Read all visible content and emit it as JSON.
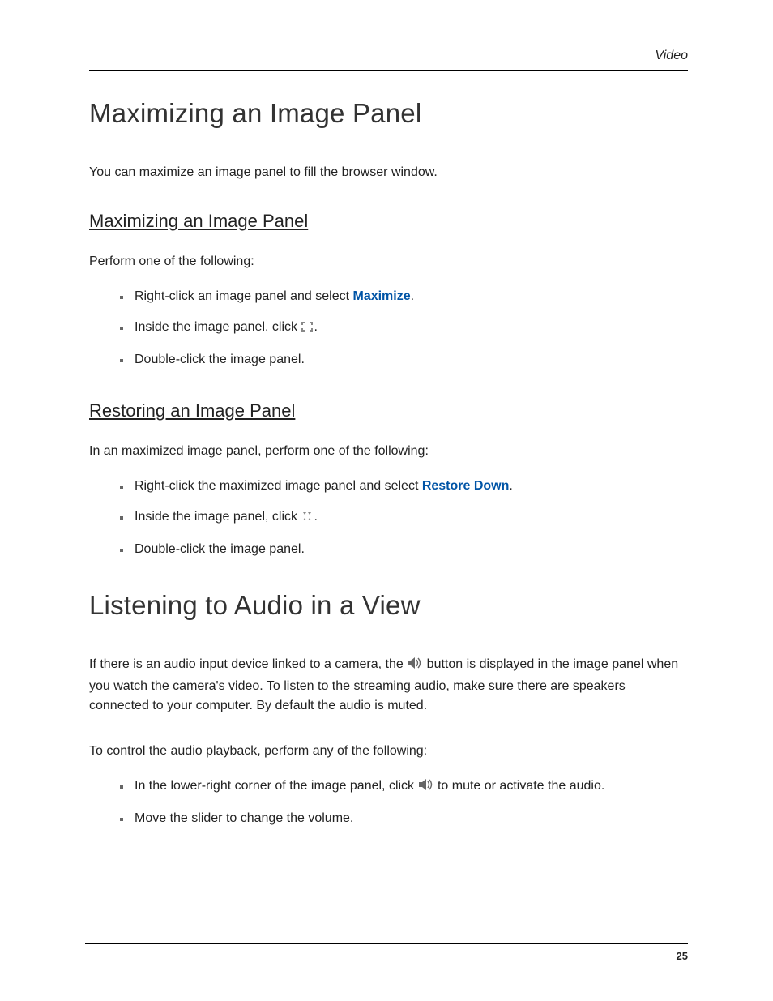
{
  "header": {
    "running": "Video"
  },
  "section1": {
    "title": "Maximizing an Image Panel",
    "intro": "You can maximize an image panel to fill the browser window.",
    "sub1": {
      "title": "Maximizing an Image Panel",
      "lead": "Perform one of the following:",
      "items": {
        "a_pre": "Right-click an image panel and select ",
        "a_kw": "Maximize",
        "a_post": ".",
        "b_pre": "Inside the image panel, click ",
        "b_post": ".",
        "c": "Double-click the image panel."
      }
    },
    "sub2": {
      "title": "Restoring an Image Panel",
      "lead": "In an maximized image panel, perform one of the following:",
      "items": {
        "a_pre": "Right-click the maximized image panel and select ",
        "a_kw": "Restore Down",
        "a_post": ".",
        "b_pre": "Inside the image panel, click ",
        "b_post": ".",
        "c": "Double-click the image panel."
      }
    }
  },
  "section2": {
    "title": "Listening to Audio in a View",
    "para_pre": "If there is an audio input device linked to a camera, the ",
    "para_post": " button is displayed in the image panel when you watch the camera's video. To listen to the streaming audio, make sure there are speakers connected to your computer. By default the audio is muted.",
    "lead": "To control the audio playback, perform any of the following:",
    "items": {
      "a_pre": "In the lower-right corner of the image panel, click ",
      "a_post": " to mute or activate the audio.",
      "b": "Move the slider to change the volume."
    }
  },
  "footer": {
    "page": "25"
  }
}
